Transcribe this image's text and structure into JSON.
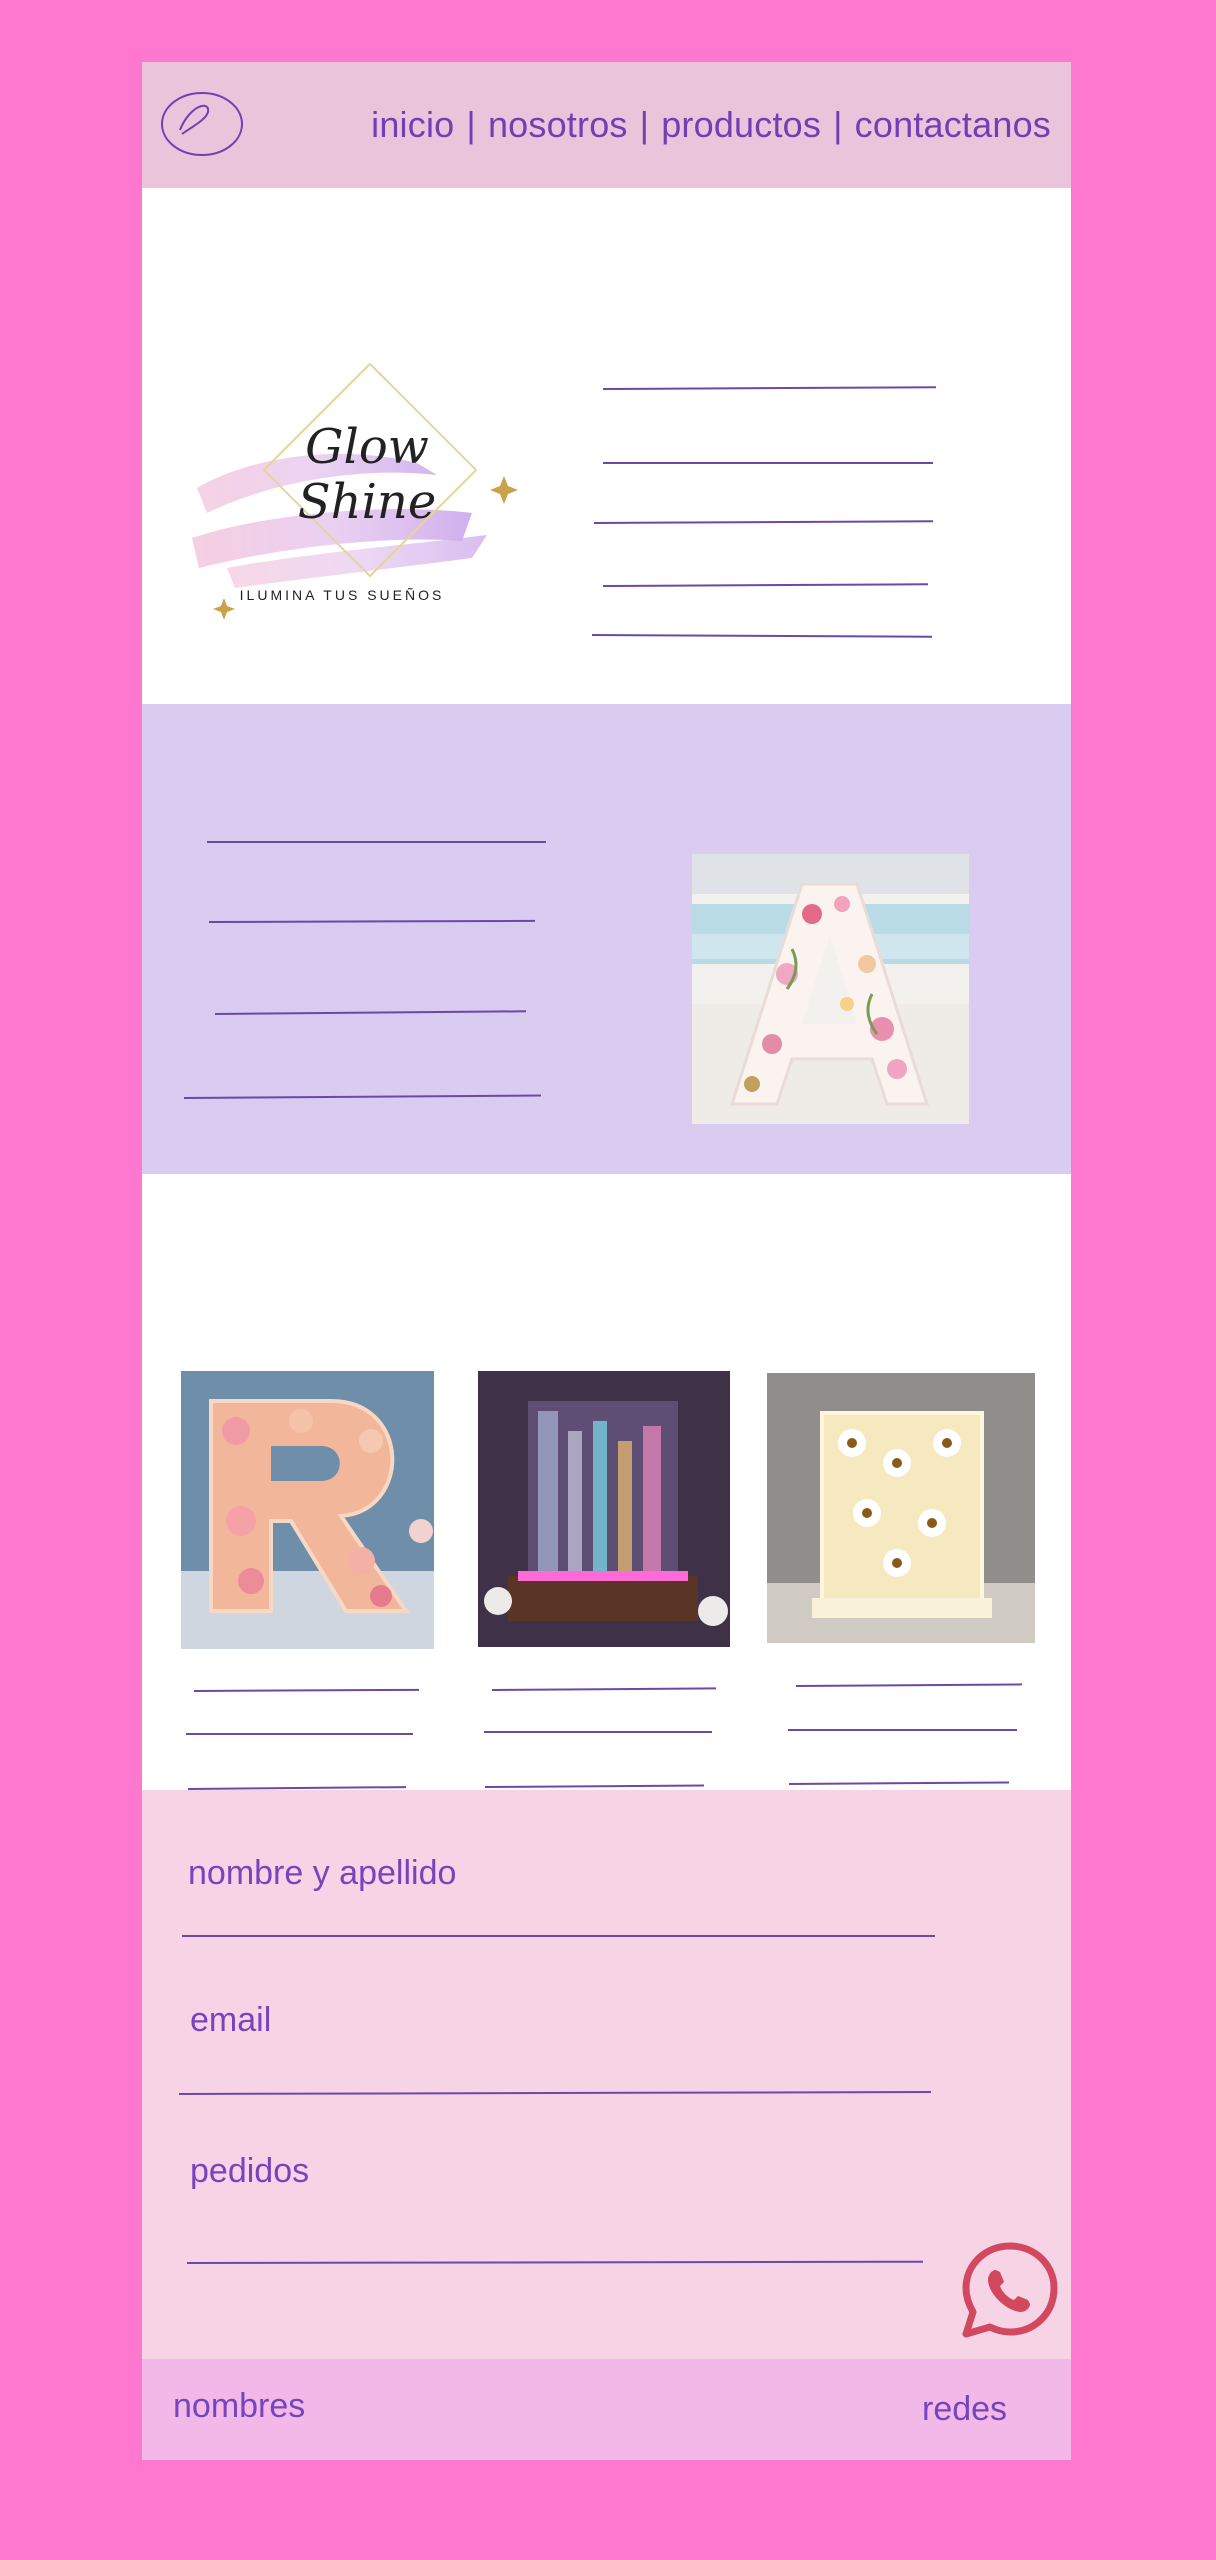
{
  "nav": {
    "items": [
      "inicio",
      "nosotros",
      "productos",
      "contactanos"
    ],
    "separator": "|"
  },
  "logo": {
    "title_line1": "Glow",
    "title_line2": "Shine",
    "tagline": "ILUMINA TUS SUEÑOS"
  },
  "form": {
    "name_label": "nombre y apellido",
    "email_label": "email",
    "orders_label": "pedidos"
  },
  "footer": {
    "left": "nombres",
    "right": "redes"
  },
  "icons": {
    "logo_placeholder": "circle-sketch-icon",
    "whatsapp": "whatsapp-icon"
  },
  "colors": {
    "page_bg": "#ff78cf",
    "header_bg": "#e9c4db",
    "about_bg": "#dacbf0",
    "contact_bg": "#f7d3e6",
    "footer_bg": "#f2b8e8",
    "text": "#7645bd",
    "line": "#6a4aa6",
    "whatsapp": "#d2485f"
  }
}
